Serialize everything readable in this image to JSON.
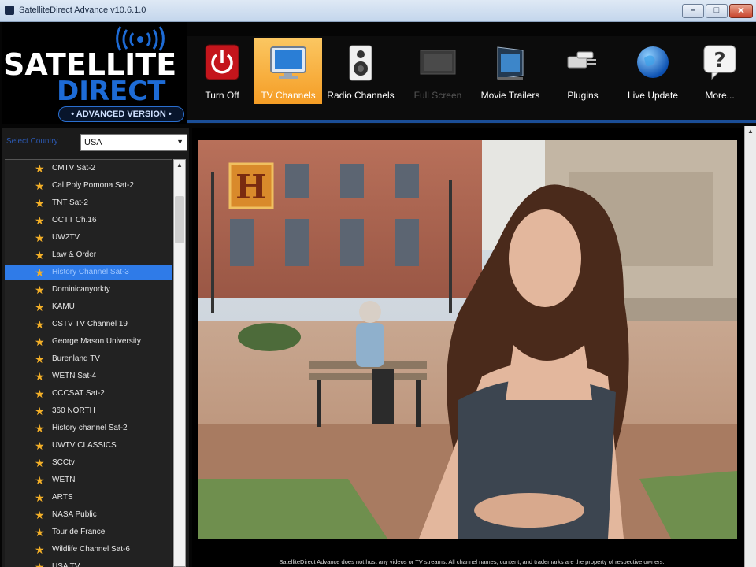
{
  "window": {
    "title": "SatelliteDirect Advance v10.6.1.0",
    "controls": {
      "minimize": "–",
      "maximize": "□",
      "close": "✕"
    }
  },
  "logo": {
    "line1": "SATELLITE",
    "line2": "DIRECT",
    "badge": "• ADVANCED VERSION •",
    "accent": "#1d6bd6"
  },
  "toolbar": {
    "items": [
      {
        "label": "Turn Off",
        "icon": "power-icon"
      },
      {
        "label": "TV Channels",
        "icon": "tv-icon",
        "active": true
      },
      {
        "label": "Radio Channels",
        "icon": "speaker-icon"
      },
      {
        "label": "Full Screen",
        "icon": "fullscreen-icon",
        "disabled": true
      },
      {
        "label": "Movie Trailers",
        "icon": "movie-icon"
      },
      {
        "label": "Plugins",
        "icon": "plugins-icon"
      },
      {
        "label": "Live Update",
        "icon": "globe-icon"
      },
      {
        "label": "More...",
        "icon": "help-icon"
      }
    ],
    "active_color": "#f7a830"
  },
  "sidebar": {
    "filter_label": "Select Country",
    "country": "USA",
    "channels": [
      "CMTV Sat-2",
      "Cal Poly Pomona Sat-2",
      "TNT Sat-2",
      "OCTT Ch.16",
      "UW2TV",
      "Law & Order",
      "History Channel Sat-3",
      "Dominicanyorkty",
      "KAMU",
      "CSTV TV Channel 19",
      "George Mason University",
      "Burenland TV",
      "WETN Sat-4",
      "CCCSAT Sat-2",
      "360 NORTH",
      "History channel Sat-2",
      "UWTV CLASSICS",
      "SCCtv",
      "WETN",
      "ARTS",
      "NASA Public",
      "Tour de France",
      "Wildlife Channel Sat-6",
      "USA TV"
    ],
    "selected_index": 6,
    "star_color": "#f4b028",
    "selected_color": "#2f7be8"
  },
  "player": {
    "channel_logo": "H",
    "disclaimer": "SatelliteDirect Advance does not host any videos or TV streams. All channel names, content, and trademarks are the property of respective owners."
  }
}
